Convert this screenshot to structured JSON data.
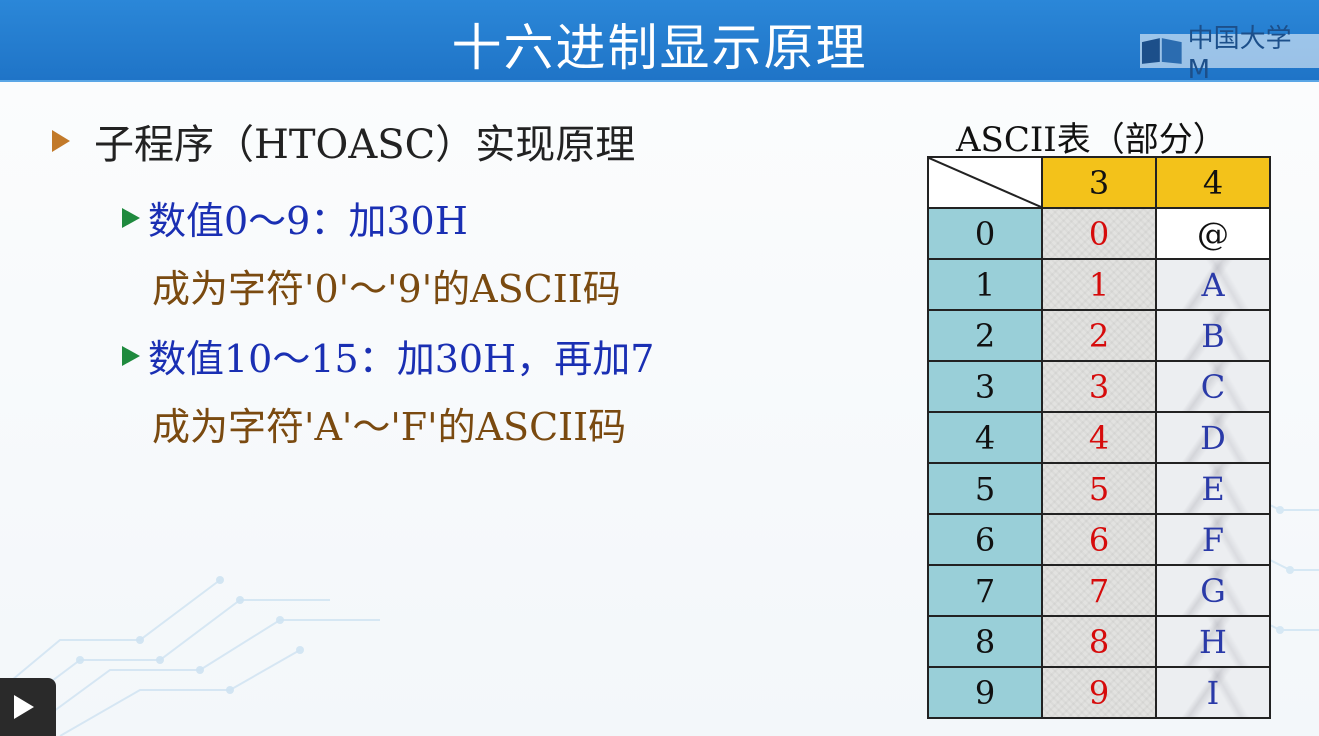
{
  "slide": {
    "title": "十六进制显示原理",
    "logo_text": "中国大学M"
  },
  "content": {
    "heading": "子程序（HTOASC）实现原理",
    "items": [
      {
        "rule": "数值0～9：加30H",
        "result": "成为字符'0'～'9'的ASCII码"
      },
      {
        "rule": "数值10～15：加30H，再加7",
        "result": "成为字符'A'～'F'的ASCII码"
      }
    ]
  },
  "ascii_table": {
    "caption": "ASCII表（部分）",
    "col_headers": [
      "3",
      "4"
    ],
    "rows": [
      {
        "low": "0",
        "col3": "0",
        "col4": "@"
      },
      {
        "low": "1",
        "col3": "1",
        "col4": "A"
      },
      {
        "low": "2",
        "col3": "2",
        "col4": "B"
      },
      {
        "low": "3",
        "col3": "3",
        "col4": "C"
      },
      {
        "low": "4",
        "col3": "4",
        "col4": "D"
      },
      {
        "low": "5",
        "col3": "5",
        "col4": "E"
      },
      {
        "low": "6",
        "col3": "6",
        "col4": "F"
      },
      {
        "low": "7",
        "col3": "7",
        "col4": "G"
      },
      {
        "low": "8",
        "col3": "8",
        "col4": "H"
      },
      {
        "low": "9",
        "col3": "9",
        "col4": "I"
      }
    ]
  },
  "icons": [
    "play-icon",
    "logo-icon",
    "bullet-arrow-icon",
    "triangle-bullet-icon"
  ],
  "colors": {
    "header_blue": "#2280d0",
    "header_yellow": "#f3c21a",
    "row_header_teal": "#99cfd8",
    "digit_red": "#d60b0b",
    "letter_blue": "#2a3aa8",
    "rule_blue": "#1a2fb3",
    "result_brown": "#7a4a10"
  }
}
